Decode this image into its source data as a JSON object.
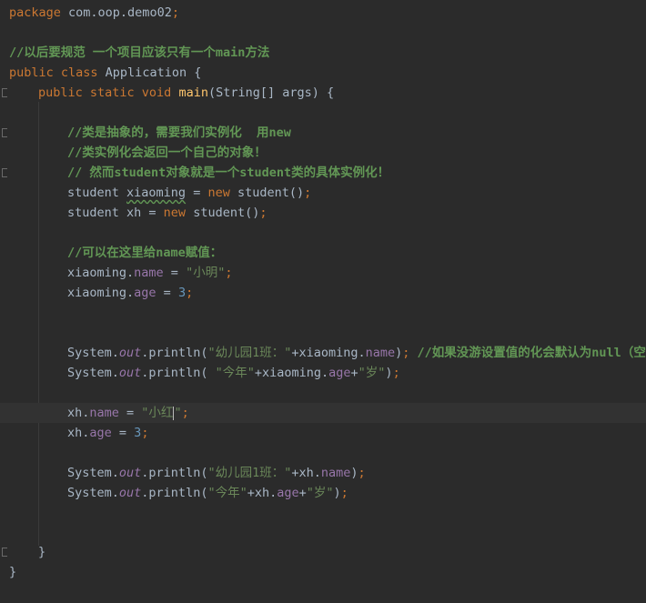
{
  "code": {
    "l1_package_kw": "package",
    "l1_package_name": " com.oop.demo02",
    "l1_semicolon": ";",
    "l3_comment": "//以后要规范 一个项目应该只有一个main方法",
    "l4_kw": "public class",
    "l4_name": " Application {",
    "l5_kw": "public static void",
    "l5_method": " main",
    "l5_rest": "(String[] args) {",
    "l7_comment": "//类是抽象的，需要我们实例化  用new",
    "l8_comment": "//类实例化会返回一个自己的对象！",
    "l9_comment": "// 然而student对象就是一个student类的具体实例化！",
    "l10_type": "student ",
    "l10_var": "xiaoming",
    "l10_eq": " = ",
    "l10_new": "new",
    "l10_rest": " student()",
    "l10_semi": ";",
    "l11_text": "student xh = ",
    "l11_new": "new",
    "l11_rest": " student()",
    "l11_semi": ";",
    "l13_comment": "//可以在这里给name赋值：",
    "l14_obj": "xiaoming.",
    "l14_field": "name",
    "l14_eq": " = ",
    "l14_str": "\"小明\"",
    "l14_semi": ";",
    "l15_obj": "xiaoming.",
    "l15_field": "age",
    "l15_eq": " = ",
    "l15_num": "3",
    "l15_semi": ";",
    "l18_sys": "System.",
    "l18_out": "out",
    "l18_call": ".println(",
    "l18_str": "\"幼儿园1班：\"",
    "l18_plus": "+xiaoming.",
    "l18_field": "name",
    "l18_close": ")",
    "l18_semi": "; ",
    "l18_comment": "//如果没游设置值的化会默认为null（空）",
    "l19_sys": "System.",
    "l19_out": "out",
    "l19_call": ".println( ",
    "l19_str1": "\"今年\"",
    "l19_plus": "+xiaoming.",
    "l19_field": "age",
    "l19_plus2": "+",
    "l19_str2": "\"岁\"",
    "l19_close": ")",
    "l19_semi": ";",
    "l21_obj": "xh.",
    "l21_field": "name",
    "l21_eq": " = ",
    "l21_str_a": "\"小红",
    "l21_str_b": "\"",
    "l21_semi": ";",
    "l22_obj": "xh.",
    "l22_field": "age",
    "l22_eq": " = ",
    "l22_num": "3",
    "l22_semi": ";",
    "l24_sys": "System.",
    "l24_out": "out",
    "l24_call": ".println(",
    "l24_str": "\"幼儿园1班：\"",
    "l24_plus": "+xh.",
    "l24_field": "name",
    "l24_close": ")",
    "l24_semi": ";",
    "l25_sys": "System.",
    "l25_out": "out",
    "l25_call": ".println(",
    "l25_str1": "\"今年\"",
    "l25_plus": "+xh.",
    "l25_field": "age",
    "l25_plus2": "+",
    "l25_str2": "\"岁\"",
    "l25_close": ")",
    "l25_semi": ";",
    "l28_brace": "}",
    "l29_brace": "}"
  },
  "colors": {
    "background": "#2b2b2b",
    "keyword": "#cc7832",
    "string": "#6a8759",
    "number": "#6897bb",
    "field": "#9876aa",
    "method": "#ffc66d",
    "comment": "#629755",
    "text": "#a9b7c6"
  }
}
